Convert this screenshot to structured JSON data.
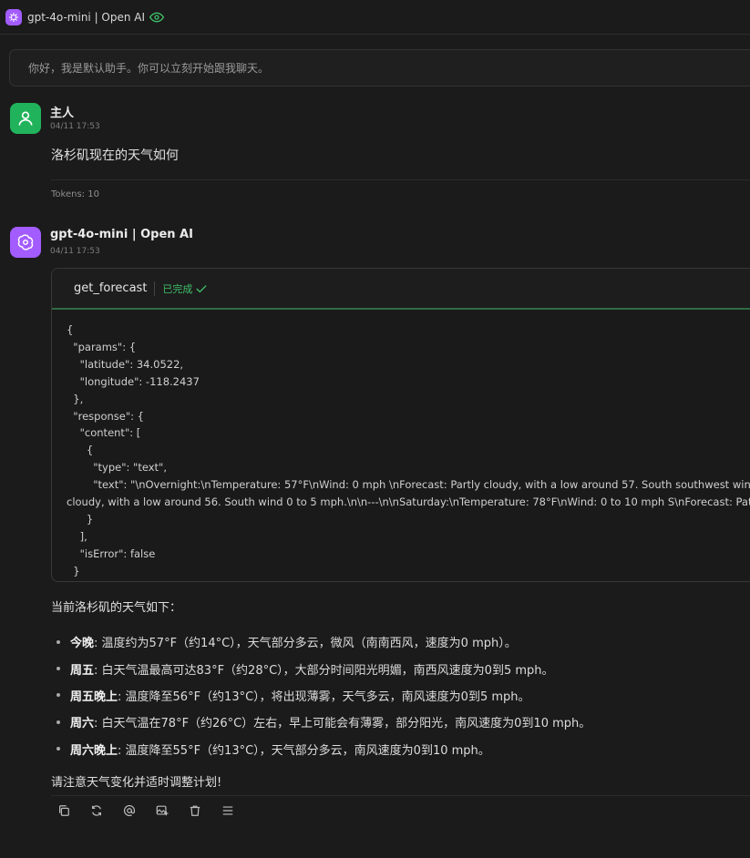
{
  "topbar": {
    "title": "gpt-4o-mini | Open AI"
  },
  "greeting": "你好，我是默认助手。你可以立刻开始跟我聊天。",
  "user_message": {
    "name": "主人",
    "time": "04/11 17:53",
    "text": "洛杉矶现在的天气如何",
    "tokens": "Tokens: 10"
  },
  "ai_message": {
    "name": "gpt-4o-mini | Open AI",
    "time": "04/11 17:53",
    "tool": {
      "name": "get_forecast",
      "status": "已完成",
      "code": "{\n  \"params\": {\n    \"latitude\": 34.0522,\n    \"longitude\": -118.2437\n  },\n  \"response\": {\n    \"content\": [\n      {\n        \"type\": \"text\",\n        \"text\": \"\\nOvernight:\\nTemperature: 57°F\\nWind: 0 mph \\nForecast: Partly cloudy, with a low around 57. South southwest wind around\ncloudy, with a low around 56. South wind 0 to 5 mph.\\n\\n---\\n\\nSaturday:\\nTemperature: 78°F\\nWind: 0 to 10 mph S\\nForecast: Patchy fog l\n      }\n    ],\n    \"isError\": false\n  }\n}"
    },
    "intro": "当前洛杉矶的天气如下：",
    "bullets": [
      {
        "label": "今晚",
        "text": ": 温度约为57°F（约14°C），天气部分多云，微风（南南西风，速度为0 mph）。"
      },
      {
        "label": "周五",
        "text": ": 白天气温最高可达83°F（约28°C），大部分时间阳光明媚，南西风速度为0到5 mph。"
      },
      {
        "label": "周五晚上",
        "text": ": 温度降至56°F（约13°C），将出现薄雾，天气多云，南风速度为0到5 mph。"
      },
      {
        "label": "周六",
        "text": ": 白天气温在78°F（约26°C）左右，早上可能会有薄雾，部分阳光，南风速度为0到10 mph。"
      },
      {
        "label": "周六晚上",
        "text": ": 温度降至55°F（约13°C），天气部分多云，南风速度为0到10 mph。"
      }
    ],
    "outro": "请注意天气变化并适时调整计划!"
  },
  "actions": [
    "copy-icon",
    "regenerate-icon",
    "mention-icon",
    "image-icon",
    "delete-icon",
    "menu-icon"
  ],
  "colors": {
    "accent_purple": "#a35cff",
    "user_green": "#21b35b",
    "done_green": "#3fbf6a"
  }
}
